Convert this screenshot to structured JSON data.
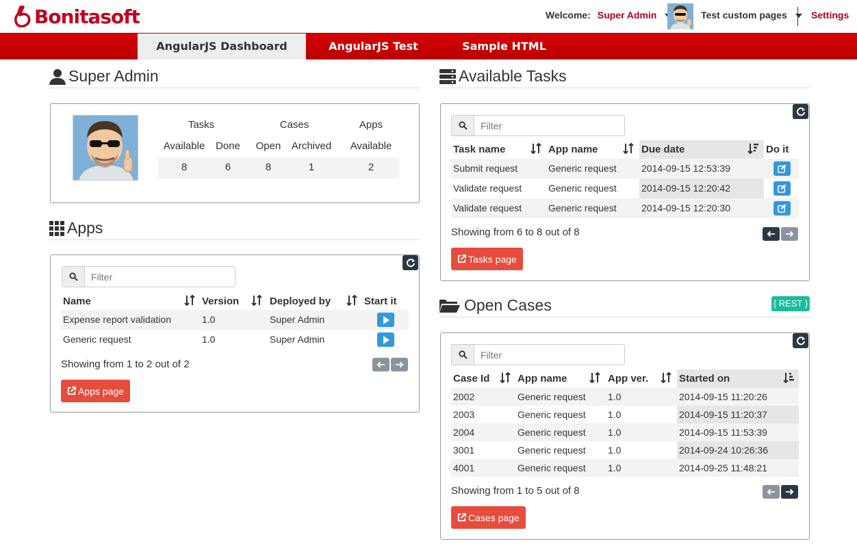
{
  "header": {
    "logo_text": "Bonitasoft",
    "welcome_label": "Welcome:",
    "user_name": "Super Admin",
    "app_name": "Test custom pages",
    "settings_label": "Settings"
  },
  "nav": {
    "tabs": [
      {
        "label": "AngularJS Dashboard",
        "active": true
      },
      {
        "label": "AngularJS Test",
        "active": false
      },
      {
        "label": "Sample HTML",
        "active": false
      }
    ]
  },
  "user_section": {
    "title": "Super Admin",
    "stats": {
      "group_tasks": "Tasks",
      "group_cases": "Cases",
      "group_apps": "Apps",
      "sub_available": "Available",
      "sub_done": "Done",
      "sub_open": "Open",
      "sub_archived": "Archived",
      "sub_apps_available": "Available",
      "tasks_available": "8",
      "tasks_done": "6",
      "cases_open": "8",
      "cases_archived": "1",
      "apps_available": "2"
    }
  },
  "apps_section": {
    "title": "Apps",
    "filter_placeholder": "Filter",
    "columns": [
      "Name",
      "Version",
      "Deployed by",
      "Start it"
    ],
    "rows": [
      {
        "name": "Expense report validation",
        "version": "1.0",
        "deployed_by": "Super Admin"
      },
      {
        "name": "Generic request",
        "version": "1.0",
        "deployed_by": "Super Admin"
      }
    ],
    "showing": "Showing from 1 to 2 out of 2",
    "page_button": "Apps page"
  },
  "tasks_section": {
    "title": "Available Tasks",
    "filter_placeholder": "Filter",
    "columns": [
      "Task name",
      "App name",
      "Due date",
      "Do it"
    ],
    "rows": [
      {
        "task": "Submit request",
        "app": "Generic request",
        "due": "2014-09-15 12:53:39"
      },
      {
        "task": "Validate request",
        "app": "Generic request",
        "due": "2014-09-15 12:20:42"
      },
      {
        "task": "Validate request",
        "app": "Generic request",
        "due": "2014-09-15 12:20:30"
      }
    ],
    "showing": "Showing from 6 to 8 out of 8",
    "page_button": "Tasks page"
  },
  "cases_section": {
    "title": "Open Cases",
    "badge": "{ REST }",
    "filter_placeholder": "Filter",
    "columns": [
      "Case Id",
      "App name",
      "App ver.",
      "Started on"
    ],
    "rows": [
      {
        "id": "2002",
        "app": "Generic request",
        "ver": "1.0",
        "started": "2014-09-15 11:20:26"
      },
      {
        "id": "2003",
        "app": "Generic request",
        "ver": "1.0",
        "started": "2014-09-15 11:20:37"
      },
      {
        "id": "2004",
        "app": "Generic request",
        "ver": "1.0",
        "started": "2014-09-15 11:53:39"
      },
      {
        "id": "3001",
        "app": "Generic request",
        "ver": "1.0",
        "started": "2014-09-24 10:26:36"
      },
      {
        "id": "4001",
        "app": "Generic request",
        "ver": "1.0",
        "started": "2014-09-25 11:48:21"
      }
    ],
    "showing": "Showing from 1 to 5 out of 8",
    "page_button": "Cases page"
  },
  "colors": {
    "brand_red": "#c1001f",
    "nav_red": "#cc0000",
    "action_red": "#e74c3c",
    "action_blue": "#3498db",
    "badge_teal": "#1abc9c",
    "dark_button": "#2b3844"
  }
}
